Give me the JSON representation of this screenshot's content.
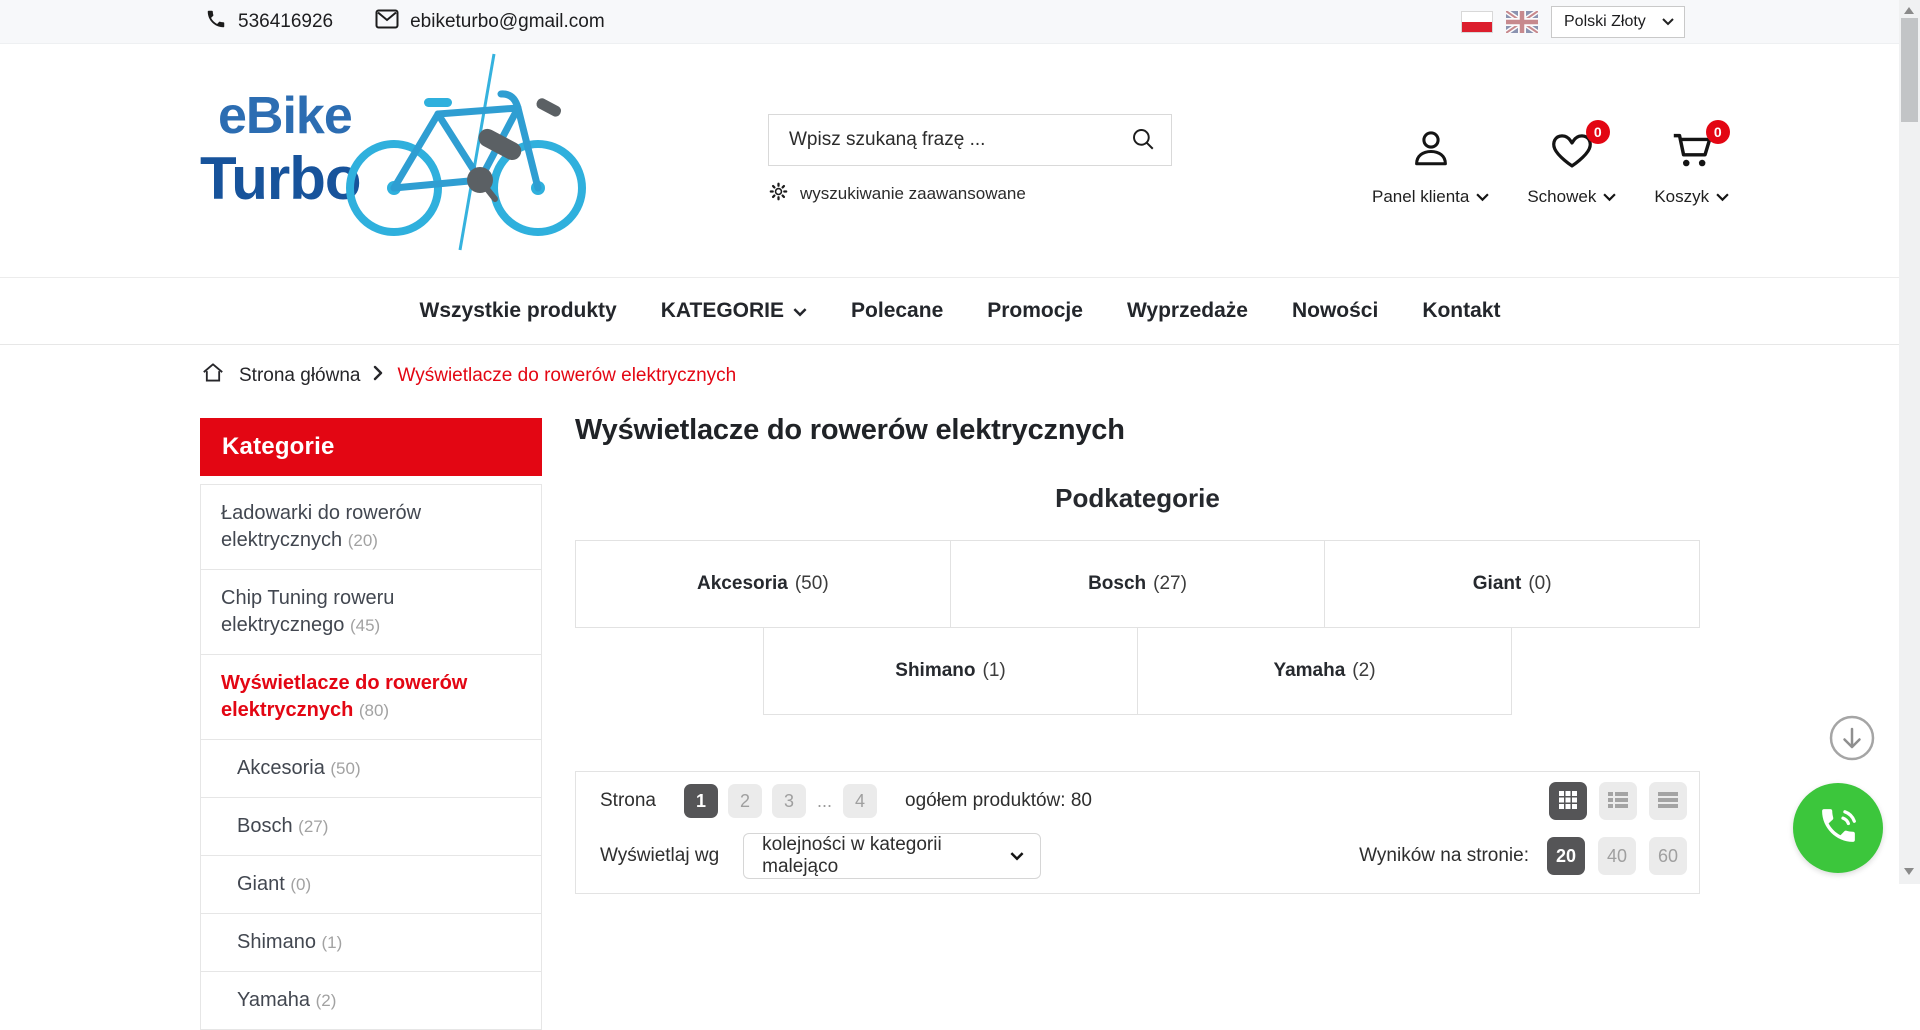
{
  "topbar": {
    "phone": "536416926",
    "email": "ebiketurbo@gmail.com",
    "currency": "Polski Złoty"
  },
  "header": {
    "logo": {
      "line1": "eBike",
      "line2": "Turbo"
    },
    "search": {
      "placeholder": "Wpisz szukaną frazę ...",
      "advanced_label": "wyszukiwanie zaawansowane"
    },
    "account": {
      "label": "Panel klienta"
    },
    "wishlist": {
      "label": "Schowek",
      "badge": "0"
    },
    "cart": {
      "label": "Koszyk",
      "badge": "0"
    }
  },
  "nav": {
    "items": [
      {
        "label": "Wszystkie produkty"
      },
      {
        "label": "KATEGORIE"
      },
      {
        "label": "Polecane"
      },
      {
        "label": "Promocje"
      },
      {
        "label": "Wyprzedaże"
      },
      {
        "label": "Nowości"
      },
      {
        "label": "Kontakt"
      }
    ]
  },
  "breadcrumb": {
    "home": "Strona główna",
    "current": "Wyświetlacze do rowerów elektrycznych"
  },
  "sidebar": {
    "title": "Kategorie",
    "items": [
      {
        "label": "Ładowarki do rowerów elektrycznych",
        "count": "(20)"
      },
      {
        "label": "Chip Tuning roweru elektrycznego",
        "count": "(45)"
      },
      {
        "label": "Wyświetlacze do rowerów elektrycznych",
        "count": "(80)"
      },
      {
        "label": "Akcesoria",
        "count": "(50)"
      },
      {
        "label": "Bosch",
        "count": "(27)"
      },
      {
        "label": "Giant",
        "count": "(0)"
      },
      {
        "label": "Shimano",
        "count": "(1)"
      },
      {
        "label": "Yamaha",
        "count": "(2)"
      }
    ]
  },
  "main": {
    "title": "Wyświetlacze do rowerów elektrycznych",
    "subcategories_heading": "Podkategorie",
    "subcategories": [
      {
        "name": "Akcesoria",
        "count": "(50)"
      },
      {
        "name": "Bosch",
        "count": "(27)"
      },
      {
        "name": "Giant",
        "count": "(0)"
      },
      {
        "name": "Shimano",
        "count": "(1)"
      },
      {
        "name": "Yamaha",
        "count": "(2)"
      }
    ],
    "toolbar": {
      "page_label": "Strona",
      "pages": [
        "1",
        "2",
        "3",
        "4"
      ],
      "active_page": "1",
      "ellipsis": "...",
      "total_label": "ogółem produktów: 80",
      "sort_label": "Wyświetlaj wg",
      "sort_value": "kolejności w kategorii malejąco",
      "per_page_label": "Wyników na stronie:",
      "per_page": [
        "20",
        "40",
        "60"
      ],
      "per_page_active": "20"
    }
  },
  "icons": {
    "phone": "handset",
    "mail": "envelope",
    "search": "magnifier",
    "gear": "advanced-search-gear",
    "user": "account-person",
    "heart": "wishlist-heart",
    "cart": "shopping-cart",
    "chevron-down": "dropdown-arrow",
    "home": "breadcrumb-home",
    "grid-view": "3x3-grid",
    "list-view": "bulleted-list",
    "compact-view": "hamburger-bars",
    "scroll-down": "circled-down-arrow",
    "call": "green-call-bubble",
    "flag-pl": "poland-flag",
    "flag-uk": "united-kingdom-flag"
  },
  "colors": {
    "accent_red": "#e30613",
    "active_gray": "#555557",
    "logo_blue_light": "#2fb0dd",
    "logo_blue_1": "#2c6db2",
    "logo_blue_2": "#17539b",
    "call_green": "#3cc63c",
    "topbar_bg": "#f7f8fa"
  }
}
